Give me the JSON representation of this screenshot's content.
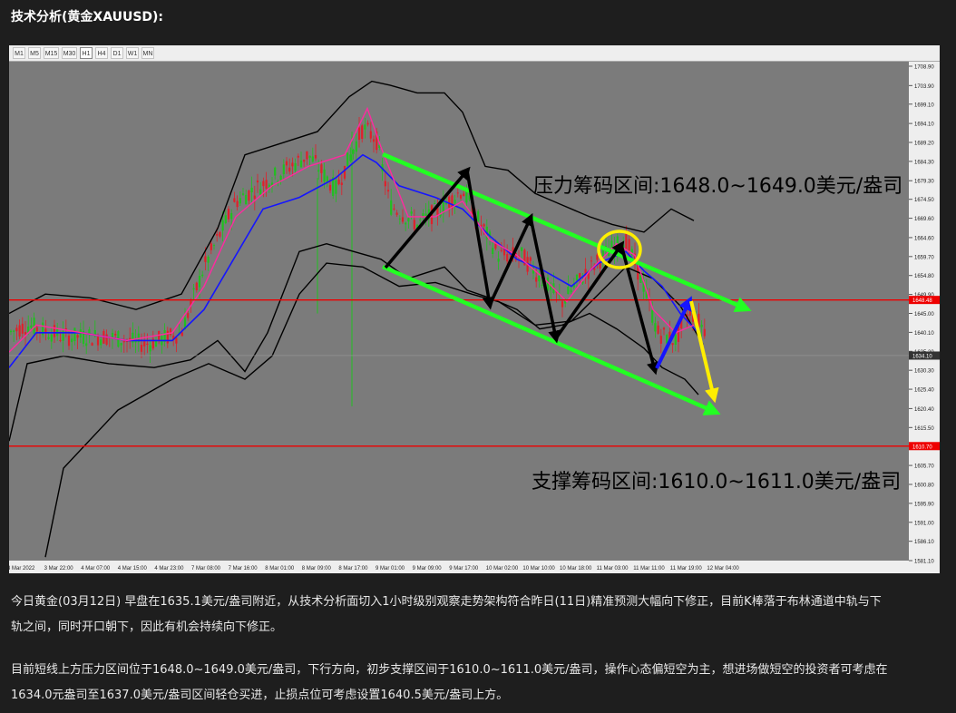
{
  "heading": "技术分析(黄金XAUUSD):",
  "timeframes": [
    "M1",
    "M5",
    "M15",
    "M30",
    "H1",
    "H4",
    "D1",
    "W1",
    "MN"
  ],
  "active_timeframe": "H1",
  "annotations": {
    "resistance": "压力筹码区间:1648.0~1649.0美元/盎司",
    "support": "支撑筹码区间:1610.0~1611.0美元/盎司"
  },
  "price_axis": [
    "1708.90",
    "1703.90",
    "1699.10",
    "1694.10",
    "1689.20",
    "1684.30",
    "1679.30",
    "1674.50",
    "1669.60",
    "1664.60",
    "1659.70",
    "1654.80",
    "1649.90",
    "1645.00",
    "1640.10",
    "1635.20",
    "1630.30",
    "1625.40",
    "1620.40",
    "1615.50",
    "1610.70",
    "1605.70",
    "1600.80",
    "1595.90",
    "1591.00",
    "1586.10",
    "1581.10"
  ],
  "price_tags": {
    "upper_line": "1648.48",
    "current": "1634.10",
    "lower_line": "1610.70"
  },
  "time_axis": [
    "3 Mar 2022",
    "3 Mar 22:00",
    "4 Mar 07:00",
    "4 Mar 15:00",
    "4 Mar 23:00",
    "7 Mar 08:00",
    "7 Mar 16:00",
    "8 Mar 01:00",
    "8 Mar 09:00",
    "8 Mar 17:00",
    "9 Mar 01:00",
    "9 Mar 09:00",
    "9 Mar 17:00",
    "10 Mar 02:00",
    "10 Mar 10:00",
    "10 Mar 18:00",
    "11 Mar 03:00",
    "11 Mar 11:00",
    "11 Mar 19:00",
    "12 Mar 04:00"
  ],
  "colors": {
    "up_candle": "#20c020",
    "down_candle": "#e0202a",
    "resistance_line": "#ee0000",
    "channel": "#22ff22",
    "middle_band": "#1515ff",
    "fast_ma": "#ff2aa0",
    "highlight": "#ffee00"
  },
  "paragraphs": [
    [
      "今日黄金(03月12日) 早盘在1635.1美元/盎司附近，从技术分析面切入1小时级别观察走势架构符合昨日(11日)精准预测大幅向下修正，目前K棒落于布林通道中轨与下",
      "轨之间，同时开口朝下，因此有机会持续向下修正。"
    ],
    [
      "目前短线上方压力区间位于1648.0~1649.0美元/盎司，下行方向，初步支撑区间于1610.0~1611.0美元/盎司，操作心态偏短空为主，想进场做短空的投资者可考虑在",
      "1634.0元盎司至1637.0美元/盎司区间轻仓买进，止损点位可考虑设置1640.5美元/盎司上方。"
    ]
  ]
}
